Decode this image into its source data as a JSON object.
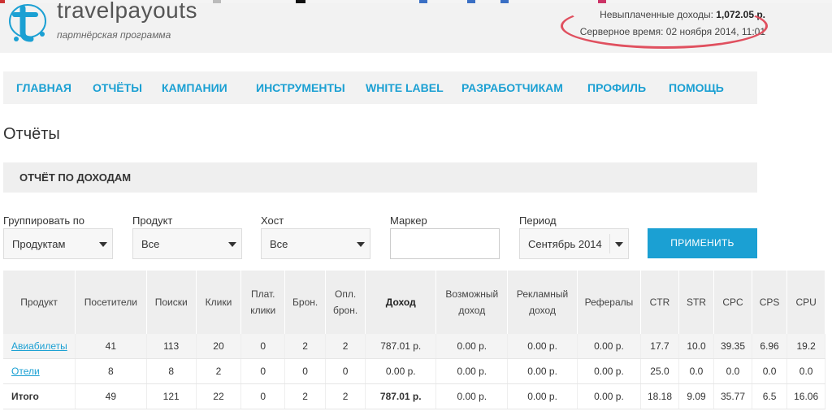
{
  "header": {
    "logo_text": "travelpayouts",
    "logo_sub": "партнёрская программа",
    "unpaid_label": "Невыплаченные доходы: ",
    "unpaid_value": "1,072.05 р.",
    "server_time": "Серверное время: 02 ноября 2014, 11:01"
  },
  "nav": [
    "Главная",
    "Отчёты",
    "Кампании",
    "Инструменты",
    "White Label",
    "Разработчикам",
    "Профиль",
    "Помощь"
  ],
  "page_title": "Отчёты",
  "section_title": "ОТЧЁТ ПО ДОХОДАМ",
  "filters": {
    "group_label": "Группировать по",
    "group_value": "Продуктам",
    "product_label": "Продукт",
    "product_value": "Все",
    "host_label": "Хост",
    "host_value": "Все",
    "marker_label": "Маркер",
    "marker_value": "",
    "period_label": "Период",
    "period_value": "Сентябрь 2014",
    "apply_label": "Применить"
  },
  "table": {
    "headers": [
      "Продукт",
      "Посетители",
      "Поиски",
      "Клики",
      "Плат. клики",
      "Брон.",
      "Опл. брон.",
      "Доход",
      "Возможный доход",
      "Рекламный доход",
      "Рефералы",
      "CTR",
      "STR",
      "CPC",
      "CPS",
      "CPU"
    ],
    "rows": [
      [
        "Авиабилеты",
        "41",
        "113",
        "20",
        "0",
        "2",
        "2",
        "787.01 р.",
        "0.00 р.",
        "0.00 р.",
        "0.00 р.",
        "17.7",
        "10.0",
        "39.35",
        "6.96",
        "19.2"
      ],
      [
        "Отели",
        "8",
        "8",
        "2",
        "0",
        "0",
        "0",
        "0.00 р.",
        "0.00 р.",
        "0.00 р.",
        "0.00 р.",
        "25.0",
        "0.0",
        "0.0",
        "0.0",
        "0.0"
      ]
    ],
    "total": [
      "Итого",
      "49",
      "121",
      "22",
      "0",
      "2",
      "2",
      "787.01 р.",
      "0.00 р.",
      "0.00 р.",
      "0.00 р.",
      "18.18",
      "9.09",
      "35.77",
      "6.5",
      "16.06"
    ]
  },
  "colors": {
    "accent": "#1ba0d3",
    "annotation": "#e0505f"
  }
}
